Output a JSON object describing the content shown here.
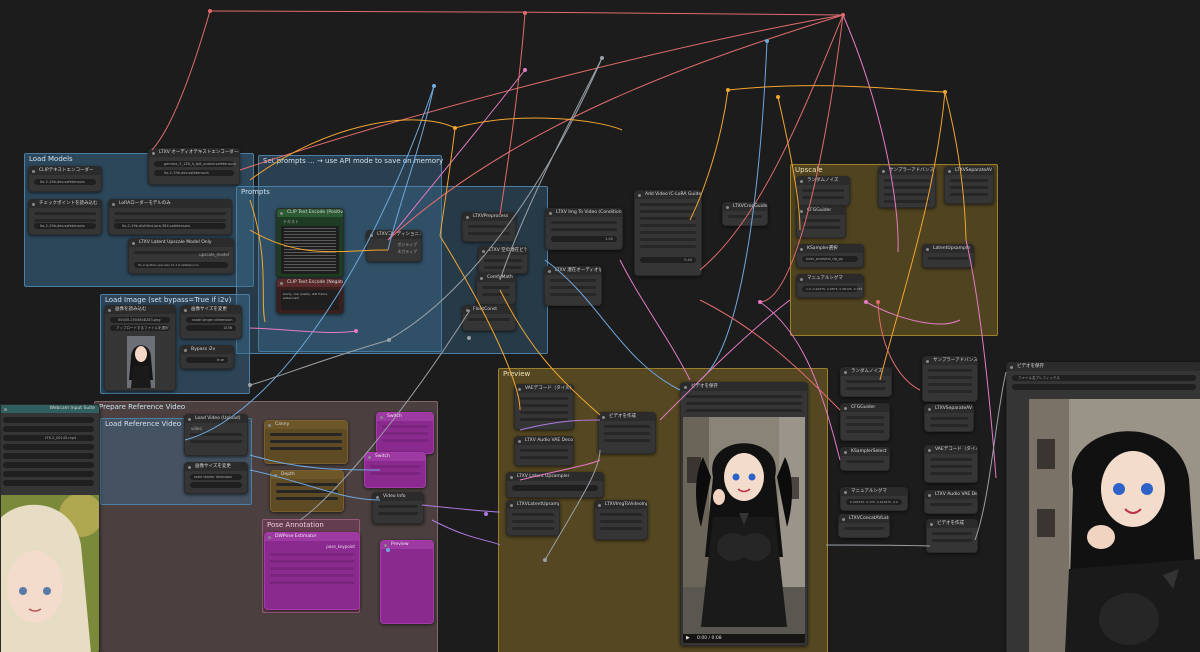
{
  "groups": {
    "load_models": "Load Models",
    "set_prompts": "Set prompts ... → use API mode to save on memory",
    "prompts": "Prompts",
    "load_image": "Load Image (set bypass=True if i2v)",
    "prepare_reference": "Prepare Reference Video",
    "load_reference": "Load Reference Video",
    "pose_annotation": "Pose Annotation",
    "preview": "Preview",
    "upscale": "Upscale"
  },
  "nodes": {
    "ltxv_loader": {
      "title": "LTXV オーディオテキストエンコーダーローダー",
      "value": "gemma_3_12B_it_fp8_scaled.safetensors",
      "value2": "ltx-2-19b-dev.safetensors"
    },
    "clip_loader": {
      "title": "CLIPテキストエンコーダー",
      "value": "ltx-2-19b-dev.safetensors"
    },
    "ckpt_loader": {
      "title": "チェックポイントを読み込む",
      "value": "ltx-2-19b-dev.safetensors"
    },
    "lora_loader": {
      "title": "LoRAローダーモデルのみ",
      "value": "ltx-2-19b-distilled-lora-384.safetensors"
    },
    "latent_upscale": {
      "title": "LTXV Latent Upscale Model Only",
      "value": "ltx-2-spatial-upscaler-x2-1.0.safetensors",
      "label": "upscale_model"
    },
    "clip_pos": {
      "title": "CLIP Text Encode (Positive Prompt)",
      "label": "テキスト"
    },
    "clip_neg": {
      "title": "CLIP Text Encode (Negative Prompt)",
      "text": "blurry, low quality, still frame, watermark"
    },
    "cond": {
      "title": "LTXVコンディショニング",
      "pos": "ポジティブ",
      "neg": "ネガティブ"
    },
    "load_image": {
      "title": "画像を読み込む",
      "file": "00045-2504648283.png",
      "choose": "アップロードするファイルを選択"
    },
    "resize_image": {
      "title": "画像サイズを変更",
      "mode": "scale longer dimension",
      "value": "1536"
    },
    "bypass": {
      "title": "Bypass i2v",
      "value": "true"
    },
    "load_video": {
      "title": "Load Video (Upload)",
      "label": "video"
    },
    "resize_video": {
      "title": "画像サイズを変更",
      "mode": "scale shorter dimension"
    },
    "ltxv_img_to_video": {
      "title": "LTXV Img To Video (Conditioning)",
      "strength": "1.00"
    },
    "add_guide": {
      "title": "Add Video IC-LoRA Guide",
      "value": "0.40"
    },
    "ltxv_sampler": {
      "title": "LTXV 空の潜在ビデオ"
    },
    "ltxv_concat": {
      "title": "LTXV 潜在オーディオを追加"
    },
    "ltxv_crop": {
      "title": "LTXVCropGuides"
    },
    "config_frames": {
      "title": "ComfyMath"
    },
    "ksampler": {
      "title": "ランダムノイズ"
    },
    "sampler_select": {
      "title": "KSampler選択",
      "value": "euler_ancestral_cfg_pp"
    },
    "manual_sigmas": {
      "title": "マニュアルシグマ",
      "value": "1.0, 0.99375, 0.9875, 0.98125, 0.975"
    },
    "vae_decode": {
      "title": "VAEデコード（タイル）"
    },
    "video_combine": {
      "title": "ビデオを作成"
    },
    "save_video": {
      "title": "ビデオを保存"
    },
    "upscale_sampler": {
      "title": "ランダムノイズ"
    },
    "upscale_manual": {
      "title": "マニュアルシグマ",
      "value": "0.909375, 0.725, 0.421875, 0.0"
    },
    "upscale_decode": {
      "title": "サンプラーアドバンスド"
    },
    "final_video": {
      "title": "ビデオを保存",
      "format": "ファイル名プレフィックス"
    },
    "pose_node": {
      "title": "DWPose Estimator",
      "label": "pose_keypoint"
    },
    "video_info": {
      "title": "Video Info"
    },
    "preview_left": {
      "title": "Webcam Input Suite",
      "value": "LTX-2_00145.mp4"
    }
  },
  "video_controls": {
    "time": "0:00 / 0:08",
    "play": "▶"
  },
  "colors": {
    "background": "#1c1c1c",
    "node": "#353535",
    "group_blue": "#3b6b8e",
    "group_brown": "#6b5656",
    "group_gold": "#7a6424",
    "node_magenta": "#8a2a8f",
    "wire_red": "#e06c6c",
    "wire_orange": "#f2a530",
    "wire_pink": "#e57bc4",
    "wire_blue": "#6fa8dc",
    "wire_gray": "#9aa0a6",
    "wire_purple": "#b07be0"
  }
}
